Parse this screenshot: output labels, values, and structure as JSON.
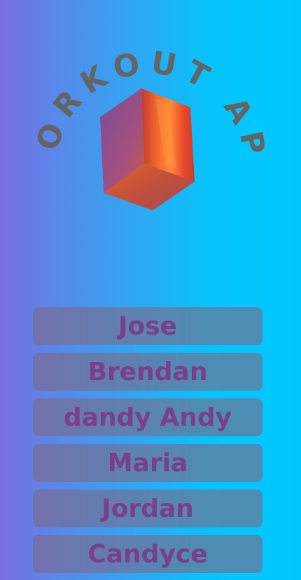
{
  "app": {
    "logo_text": "WORKOUT APP",
    "logo_icon": "3d-box-icon"
  },
  "users": [
    {
      "name": "Jose"
    },
    {
      "name": "Brendan"
    },
    {
      "name": "dandy Andy"
    },
    {
      "name": "Maria"
    },
    {
      "name": "Jordan"
    },
    {
      "name": "Candyce"
    }
  ],
  "colors": {
    "background_left": "#7a6ee4",
    "background_right": "#00c8ff",
    "button_bg": "#7a6a88",
    "button_text": "#7a3f8c",
    "logo_text": "#646464"
  }
}
